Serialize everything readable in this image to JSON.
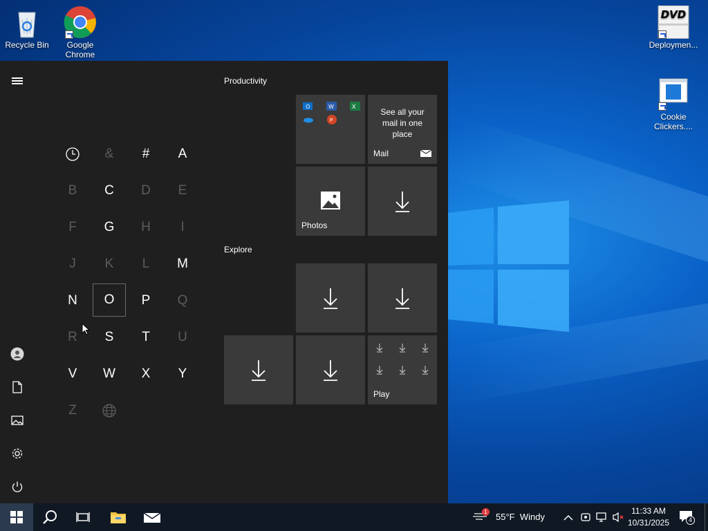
{
  "desktop": {
    "icons": [
      {
        "label": "Recycle Bin"
      },
      {
        "label": "Google Chrome"
      },
      {
        "label": "Deploymen..."
      },
      {
        "label": "Cookie Clickers...."
      }
    ]
  },
  "start_menu": {
    "jump_letters": [
      {
        "label": "clock",
        "enabled": true
      },
      {
        "label": "&",
        "enabled": false
      },
      {
        "label": "#",
        "enabled": true
      },
      {
        "label": "A",
        "enabled": true
      },
      {
        "label": "B",
        "enabled": false
      },
      {
        "label": "C",
        "enabled": true
      },
      {
        "label": "D",
        "enabled": false
      },
      {
        "label": "E",
        "enabled": false
      },
      {
        "label": "F",
        "enabled": false
      },
      {
        "label": "G",
        "enabled": true
      },
      {
        "label": "H",
        "enabled": false
      },
      {
        "label": "I",
        "enabled": false
      },
      {
        "label": "J",
        "enabled": false
      },
      {
        "label": "K",
        "enabled": false
      },
      {
        "label": "L",
        "enabled": false
      },
      {
        "label": "M",
        "enabled": true
      },
      {
        "label": "N",
        "enabled": true
      },
      {
        "label": "O",
        "enabled": true,
        "selected": true
      },
      {
        "label": "P",
        "enabled": true
      },
      {
        "label": "Q",
        "enabled": false
      },
      {
        "label": "R",
        "enabled": false
      },
      {
        "label": "S",
        "enabled": true
      },
      {
        "label": "T",
        "enabled": true
      },
      {
        "label": "U",
        "enabled": false
      },
      {
        "label": "V",
        "enabled": true
      },
      {
        "label": "W",
        "enabled": true
      },
      {
        "label": "X",
        "enabled": true
      },
      {
        "label": "Y",
        "enabled": true
      },
      {
        "label": "Z",
        "enabled": false
      },
      {
        "label": "globe",
        "enabled": false
      }
    ],
    "groups": {
      "productivity": "Productivity",
      "explore": "Explore"
    },
    "tiles": {
      "mail_text": "See all your mail in one place",
      "mail_label": "Mail",
      "photos_label": "Photos",
      "play_label": "Play"
    }
  },
  "taskbar": {
    "weather": "55°F  Windy",
    "weather_badge": "1",
    "time": "11:33 AM",
    "date": "10/31/2025",
    "notifications_count": "4"
  },
  "colors": {
    "start_bg": "#1f1f1f",
    "tile_bg": "#3a3a3a",
    "taskbar_bg": "#101824"
  }
}
